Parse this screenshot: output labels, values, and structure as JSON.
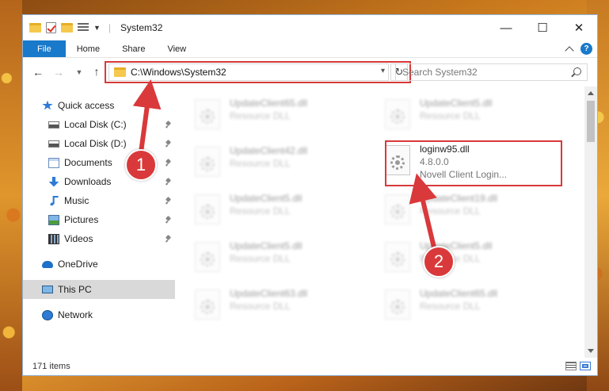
{
  "window": {
    "title": "System32",
    "controls": {
      "minimize": "—",
      "maximize": "☐",
      "close": "✕"
    }
  },
  "ribbon": {
    "tabs": [
      {
        "label": "File",
        "active": true
      },
      {
        "label": "Home"
      },
      {
        "label": "Share"
      },
      {
        "label": "View"
      }
    ],
    "help": "?"
  },
  "address": {
    "path": "C:\\Windows\\System32",
    "search_placeholder": "Search System32"
  },
  "navigation": {
    "items": [
      {
        "label": "Quick access",
        "icon": "quick-access-star-icon"
      },
      {
        "label": "Local Disk (C:)",
        "icon": "local-disk-icon",
        "pinned": true
      },
      {
        "label": "Local Disk (D:)",
        "icon": "local-disk-icon",
        "pinned": true
      },
      {
        "label": "Documents",
        "icon": "documents-icon",
        "pinned": true
      },
      {
        "label": "Downloads",
        "icon": "downloads-icon",
        "pinned": true
      },
      {
        "label": "Music",
        "icon": "music-icon",
        "pinned": true
      },
      {
        "label": "Pictures",
        "icon": "pictures-icon",
        "pinned": true
      },
      {
        "label": "Videos",
        "icon": "videos-icon",
        "pinned": true
      },
      {
        "label": "OneDrive",
        "icon": "onedrive-cloud-icon"
      },
      {
        "label": "This PC",
        "icon": "this-pc-icon",
        "selected": true
      },
      {
        "label": "Network",
        "icon": "network-icon"
      }
    ]
  },
  "files": {
    "left_column": [
      {
        "name": "UpdateClient65.dll",
        "type": "Resource DLL"
      },
      {
        "name": "UpdateClient42.dll",
        "type": "Resource DLL"
      },
      {
        "name": "UpdateClient5.dll",
        "type": "Resource DLL"
      },
      {
        "name": "UpdateClient5.dll",
        "type": "Resource DLL"
      },
      {
        "name": "UpdateClient63.dll",
        "type": "Resource DLL"
      }
    ],
    "right_column": [
      {
        "name": "UpdateClient5.dll",
        "type": "Resource DLL"
      },
      {
        "name": "loginw95.dll",
        "version": "4.8.0.0",
        "description": "Novell Client Login...",
        "highlighted": true
      },
      {
        "name": "UpdateClient19.dll",
        "type": "Resource DLL"
      },
      {
        "name": "UpdateClient5.dll",
        "type": "Resource DLL"
      },
      {
        "name": "UpdateClient65.dll",
        "type": "Resource DLL"
      }
    ]
  },
  "status": {
    "item_count": "171 items"
  },
  "callouts": {
    "one": "1",
    "two": "2"
  },
  "colors": {
    "accent": "#1979ca",
    "highlight": "#d9393a"
  }
}
